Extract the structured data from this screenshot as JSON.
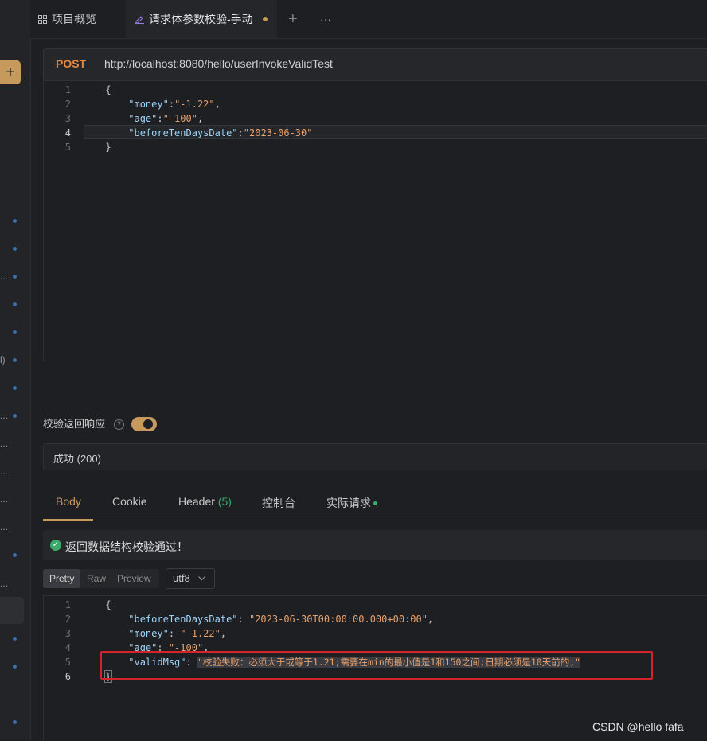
{
  "tabs": {
    "overview_label": "项目概览",
    "active_label": "请求体参数校验-手动",
    "add_label": "+",
    "more_label": "···"
  },
  "sidebar": {
    "add_label": "+",
    "truncated": [
      "...",
      "l)",
      "...",
      "...",
      "...",
      "...",
      "...",
      "..."
    ]
  },
  "request": {
    "method": "POST",
    "url": "http://localhost:8080/hello/userInvokeValidTest",
    "body_lines": [
      {
        "n": "1",
        "text": "{"
      },
      {
        "n": "2",
        "key": "\"money\"",
        "sep": ":",
        "val": "\"-1.22\"",
        "end": ","
      },
      {
        "n": "3",
        "key": "\"age\"",
        "sep": ":",
        "val": "\"-100\"",
        "end": ","
      },
      {
        "n": "4",
        "key": "\"beforeTenDaysDate\"",
        "sep": ":",
        "val": "\"2023-06-30\"",
        "end": ""
      },
      {
        "n": "5",
        "text": "}"
      }
    ]
  },
  "validate": {
    "label": "校验返回响应",
    "help": "?",
    "enabled": true
  },
  "status": {
    "text": "成功 (200)"
  },
  "response_tabs": [
    {
      "label": "Body"
    },
    {
      "label": "Cookie"
    },
    {
      "label": "Header",
      "count": "(5)"
    },
    {
      "label": "控制台"
    },
    {
      "label": "实际请求"
    }
  ],
  "notice": {
    "text": "返回数据结构校验通过！"
  },
  "format": {
    "pretty": "Pretty",
    "raw": "Raw",
    "preview": "Preview",
    "encoding": "utf8"
  },
  "response": {
    "lines": [
      {
        "n": "1",
        "text": "{"
      },
      {
        "n": "2",
        "key": "\"beforeTenDaysDate\"",
        "sep": ": ",
        "val": "\"2023-06-30T00:00:00.000+00:00\"",
        "end": ","
      },
      {
        "n": "3",
        "key": "\"money\"",
        "sep": ": ",
        "val": "\"-1.22\"",
        "end": ","
      },
      {
        "n": "4",
        "key": "\"age\"",
        "sep": ": ",
        "val": "\"-100\"",
        "end": ","
      },
      {
        "n": "5",
        "key": "\"validMsg\"",
        "sep": ": ",
        "val": "\"校验失败：必须大于或等于1.21;需要在min的最小值是1和150之间;日期必须是10天前的;\"",
        "end": ""
      },
      {
        "n": "6",
        "text": "}"
      }
    ]
  },
  "watermark": "CSDN @hello fafa",
  "colors": {
    "accent": "#c69a5d",
    "method": "#e5883d",
    "json_key": "#9fd3f7",
    "json_string": "#e4a06f",
    "success": "#3aa96a",
    "highlight_box": "#d2242a"
  }
}
